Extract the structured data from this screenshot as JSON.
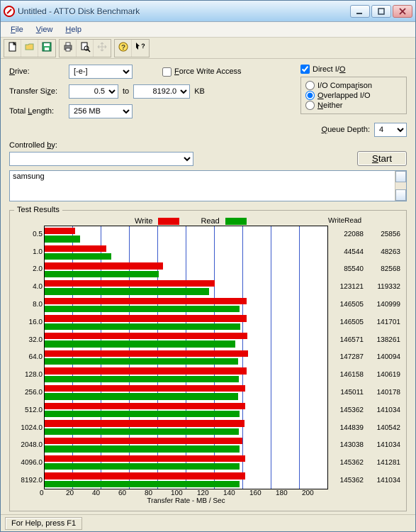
{
  "window": {
    "title": "Untitled - ATTO Disk Benchmark"
  },
  "menus": {
    "file": "File",
    "view": "View",
    "help": "Help"
  },
  "labels": {
    "drive": "Drive:",
    "transfer_size": "Transfer Size:",
    "to": "to",
    "kb": "KB",
    "total_length": "Total Length:",
    "force_write": "Force Write Access",
    "direct_io": "Direct I/O",
    "io_comparison": "I/O Comparison",
    "overlapped_io": "Overlapped I/O",
    "neither": "Neither",
    "queue_depth": "Queue Depth:",
    "controlled_by": "Controlled by:",
    "start": "Start",
    "results_legend": "Test Results",
    "write": "Write",
    "read": "Read",
    "xlabel": "Transfer Rate - MB / Sec",
    "status": "For Help, press F1"
  },
  "settings": {
    "drive": "[-e-]",
    "size_from": "0.5",
    "size_to": "8192.0",
    "total_length": "256 MB",
    "force_write": false,
    "direct_io": true,
    "mode": "overlapped",
    "queue_depth": "4",
    "controlled_by": ""
  },
  "notes": "samsung",
  "chart_data": {
    "type": "bar",
    "unit": "KB/s",
    "xmax_mb": 200,
    "xlabel": "Transfer Rate - MB / Sec",
    "xticks": [
      "0",
      "20",
      "40",
      "60",
      "80",
      "100",
      "120",
      "140",
      "160",
      "180",
      "200"
    ],
    "series": [
      {
        "name": "Write",
        "color": "#e60000"
      },
      {
        "name": "Read",
        "color": "#00a000"
      }
    ],
    "rows": [
      {
        "label": "0.5",
        "write": 22088,
        "read": 25856
      },
      {
        "label": "1.0",
        "write": 44544,
        "read": 48263
      },
      {
        "label": "2.0",
        "write": 85540,
        "read": 82568
      },
      {
        "label": "4.0",
        "write": 123121,
        "read": 119332
      },
      {
        "label": "8.0",
        "write": 146505,
        "read": 140999
      },
      {
        "label": "16.0",
        "write": 146505,
        "read": 141701
      },
      {
        "label": "32.0",
        "write": 146571,
        "read": 138261
      },
      {
        "label": "64.0",
        "write": 147287,
        "read": 140094
      },
      {
        "label": "128.0",
        "write": 146158,
        "read": 140619
      },
      {
        "label": "256.0",
        "write": 145011,
        "read": 140178
      },
      {
        "label": "512.0",
        "write": 145362,
        "read": 141034
      },
      {
        "label": "1024.0",
        "write": 144839,
        "read": 140542
      },
      {
        "label": "2048.0",
        "write": 143038,
        "read": 141034
      },
      {
        "label": "4096.0",
        "write": 145362,
        "read": 141281
      },
      {
        "label": "8192.0",
        "write": 145362,
        "read": 141034
      }
    ]
  }
}
